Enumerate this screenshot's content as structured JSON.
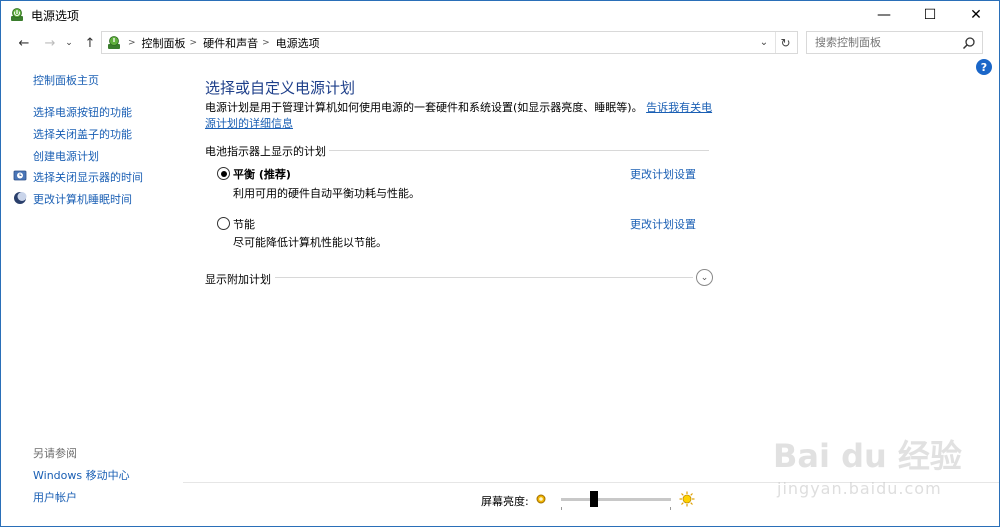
{
  "window": {
    "title": "电源选项",
    "controls": {
      "minimize": "—",
      "maximize": "☐",
      "close": "✕"
    }
  },
  "nav": {
    "back": "←",
    "forward": "→",
    "recent": "⌄",
    "up": "↑",
    "breadcrumbs": [
      "控制面板",
      "硬件和声音",
      "电源选项"
    ],
    "dropdown": "⌄",
    "refresh": "↻"
  },
  "search": {
    "placeholder": "搜索控制面板"
  },
  "help": "?",
  "sidebar": {
    "home": "控制面板主页",
    "links": [
      "选择电源按钮的功能",
      "选择关闭盖子的功能",
      "创建电源计划",
      "选择关闭显示器的时间",
      "更改计算机睡眠时间"
    ],
    "see_also": {
      "heading": "另请参阅",
      "links": [
        "Windows 移动中心",
        "用户帐户"
      ]
    }
  },
  "main": {
    "title": "选择或自定义电源计划",
    "description": "电源计划是用于管理计算机如何使用电源的一套硬件和系统设置(如显示器亮度、睡眠等)。",
    "description_link": "告诉我有关电源计划的详细信息",
    "battery_section": "电池指示器上显示的计划",
    "plans": [
      {
        "name": "平衡 (推荐)",
        "desc": "利用可用的硬件自动平衡功耗与性能。",
        "link": "更改计划设置",
        "selected": true
      },
      {
        "name": "节能",
        "desc": "尽可能降低计算机性能以节能。",
        "link": "更改计划设置",
        "selected": false
      }
    ],
    "additional_section": "显示附加计划"
  },
  "brightness": {
    "label": "屏幕亮度:",
    "level_fraction": 0.3
  },
  "watermark": {
    "text": "Bai du 经验",
    "sub": "jingyan.baidu.com"
  }
}
